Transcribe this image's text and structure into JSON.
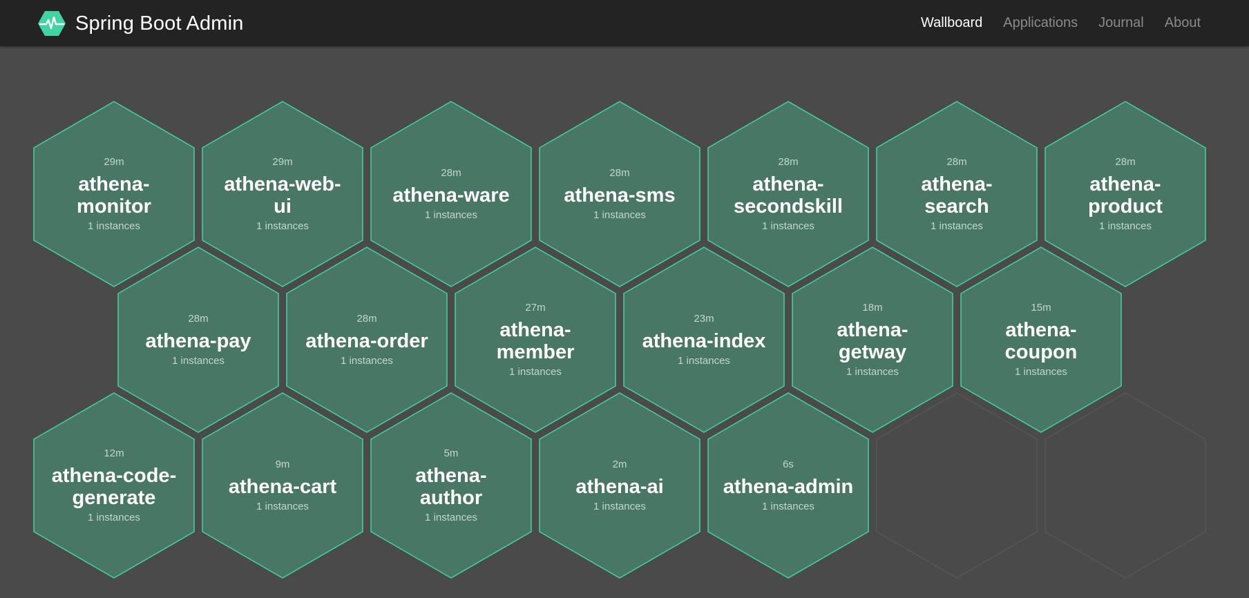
{
  "navbar": {
    "brand_icon": "heartbeat-hexagon-icon",
    "brand_color": "#42d3a5",
    "title": "Spring Boot Admin",
    "links": [
      {
        "label": "Wallboard",
        "active": true
      },
      {
        "label": "Applications",
        "active": false
      },
      {
        "label": "Journal",
        "active": false
      },
      {
        "label": "About",
        "active": false
      }
    ]
  },
  "colors": {
    "background": "#4a4a4a",
    "navbar": "#232323",
    "hex_fill": "#487766",
    "hex_border": "#42d3a5",
    "empty_hex_border": "#595959"
  },
  "applications": [
    {
      "name": "athena-monitor",
      "time": "29m",
      "instances": "1 instances"
    },
    {
      "name": "athena-web-ui",
      "time": "29m",
      "instances": "1 instances"
    },
    {
      "name": "athena-ware",
      "time": "28m",
      "instances": "1 instances"
    },
    {
      "name": "athena-sms",
      "time": "28m",
      "instances": "1 instances"
    },
    {
      "name": "athena-secondskill",
      "time": "28m",
      "instances": "1 instances"
    },
    {
      "name": "athena-search",
      "time": "28m",
      "instances": "1 instances"
    },
    {
      "name": "athena-product",
      "time": "28m",
      "instances": "1 instances"
    },
    {
      "name": "athena-pay",
      "time": "28m",
      "instances": "1 instances"
    },
    {
      "name": "athena-order",
      "time": "28m",
      "instances": "1 instances"
    },
    {
      "name": "athena-member",
      "time": "27m",
      "instances": "1 instances"
    },
    {
      "name": "athena-index",
      "time": "23m",
      "instances": "1 instances"
    },
    {
      "name": "athena-getway",
      "time": "18m",
      "instances": "1 instances"
    },
    {
      "name": "athena-coupon",
      "time": "15m",
      "instances": "1 instances"
    },
    {
      "name": "athena-code-generate",
      "time": "12m",
      "instances": "1 instances"
    },
    {
      "name": "athena-cart",
      "time": "9m",
      "instances": "1 instances"
    },
    {
      "name": "athena-author",
      "time": "5m",
      "instances": "1 instances"
    },
    {
      "name": "athena-ai",
      "time": "2m",
      "instances": "1 instances"
    },
    {
      "name": "athena-admin",
      "time": "6s",
      "instances": "1 instances"
    }
  ]
}
